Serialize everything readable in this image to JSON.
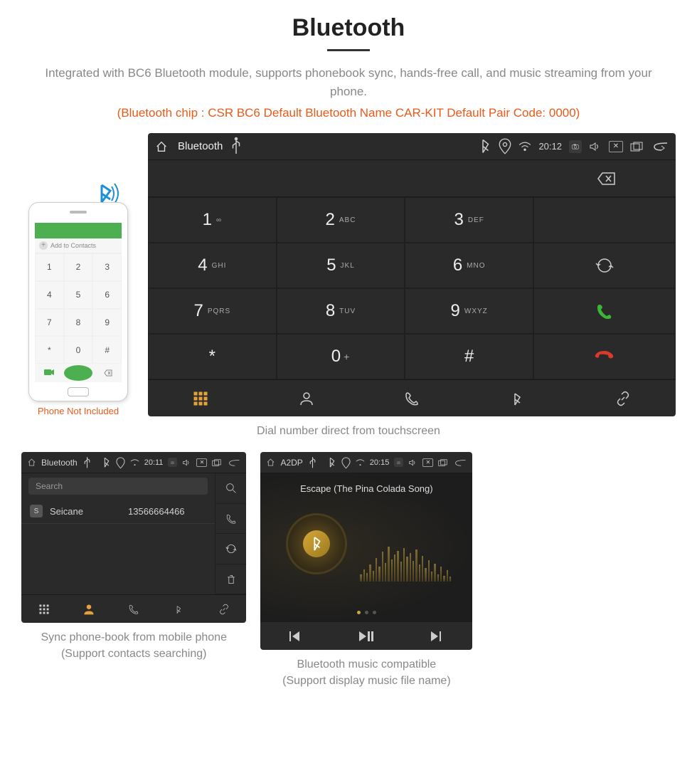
{
  "header": {
    "title": "Bluetooth",
    "description": "Integrated with BC6 Bluetooth module, supports phonebook sync, hands-free call, and music streaming from your phone.",
    "specs": "(Bluetooth chip : CSR BC6     Default Bluetooth Name CAR-KIT     Default Pair Code: 0000)"
  },
  "phone": {
    "add_label": "Add to Contacts",
    "note": "Phone Not Included",
    "small_keys": [
      "1",
      "2",
      "3",
      "4",
      "5",
      "6",
      "7",
      "8",
      "9",
      "*",
      "0",
      "#"
    ]
  },
  "dialer": {
    "status": {
      "title": "Bluetooth",
      "time": "20:12"
    },
    "keypad": [
      {
        "n": "1",
        "s": "∞"
      },
      {
        "n": "2",
        "s": "ABC"
      },
      {
        "n": "3",
        "s": "DEF"
      },
      {
        "n": "4",
        "s": "GHI"
      },
      {
        "n": "5",
        "s": "JKL"
      },
      {
        "n": "6",
        "s": "MNO"
      },
      {
        "n": "7",
        "s": "PQRS"
      },
      {
        "n": "8",
        "s": "TUV"
      },
      {
        "n": "9",
        "s": "WXYZ"
      },
      {
        "n": "*",
        "s": ""
      },
      {
        "n": "0",
        "s": "+",
        "sup": true
      },
      {
        "n": "#",
        "s": ""
      }
    ],
    "caption": "Dial number direct from touchscreen"
  },
  "contacts": {
    "status": {
      "title": "Bluetooth",
      "time": "20:11"
    },
    "search_placeholder": "Search",
    "rows": [
      {
        "badge": "S",
        "name": "Seicane",
        "number": "13566664466"
      }
    ],
    "caption_line1": "Sync phone-book from mobile phone",
    "caption_line2": "(Support contacts searching)"
  },
  "music": {
    "status": {
      "title": "A2DP",
      "time": "20:15"
    },
    "song": "Escape (The Pina Colada Song)",
    "caption_line1": "Bluetooth music compatible",
    "caption_line2": "(Support display music file name)"
  }
}
